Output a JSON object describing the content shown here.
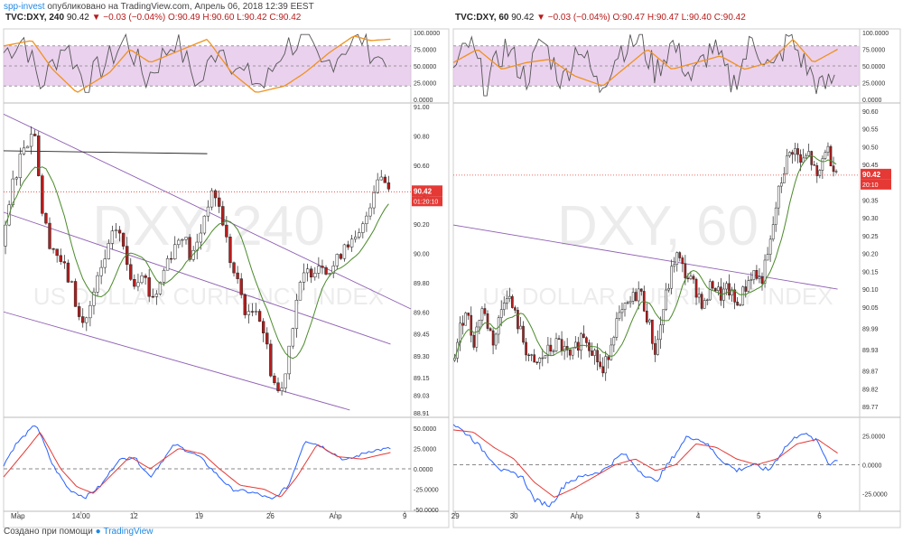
{
  "header": {
    "publisher": "spp-invest",
    "published_text": "опубликовано на TradingView.com, Апрель 06, 2018 12:39 EEST"
  },
  "footer": {
    "created_text": "Создано при помощи",
    "brand": "TradingView"
  },
  "colors": {
    "bull": "#ffffff",
    "bear": "#b71c1c",
    "wick": "#222222",
    "ma": "#4a8a2a",
    "stoch_k": "#555555",
    "stoch_d": "#f0921e",
    "rsi_band": "#e1bee7",
    "channel": "#8e5fb3",
    "macd": "#2962ff",
    "signal": "#e53935",
    "price_line": "#e53935"
  },
  "chart_data": [
    {
      "type": "candlestick",
      "symbol": "TVC:DXY",
      "interval": "240",
      "legend": {
        "prefix": "TVC:DXY, 240",
        "close": "90.42",
        "change": "▼ −0.03 (−0.04%)",
        "ohlc": "O:90.49 H:90.60 L:90.42 C:90.42"
      },
      "watermark_1": "DXY, 240",
      "watermark_2": "US DOLLAR CURRENCY INDEX",
      "price_ticks": [
        "91.00",
        "90.80",
        "90.60",
        "90.40",
        "90.20",
        "90.00",
        "89.80",
        "89.60",
        "89.45",
        "89.30",
        "89.15",
        "89.03",
        "88.91"
      ],
      "price_tick_values": [
        91.0,
        90.8,
        90.6,
        90.4,
        90.2,
        90.0,
        89.8,
        89.6,
        89.45,
        89.3,
        89.15,
        89.03,
        88.91
      ],
      "price_range": [
        88.88,
        91.02
      ],
      "last_price": "90.42",
      "last_value": 90.42,
      "countdown": "01:20:10",
      "x_ticks": [
        "Мар",
        "14:00",
        "12",
        "19",
        "26",
        "Апр",
        "9"
      ],
      "x_tick_pos": [
        0.035,
        0.19,
        0.32,
        0.48,
        0.655,
        0.815,
        0.985
      ],
      "ohlc_anchors": [
        [
          0.0,
          90.05
        ],
        [
          0.02,
          90.45
        ],
        [
          0.05,
          90.75
        ],
        [
          0.08,
          90.85
        ],
        [
          0.09,
          90.35
        ],
        [
          0.11,
          90.1
        ],
        [
          0.14,
          89.95
        ],
        [
          0.17,
          89.75
        ],
        [
          0.19,
          89.5
        ],
        [
          0.21,
          89.6
        ],
        [
          0.23,
          89.8
        ],
        [
          0.26,
          90.05
        ],
        [
          0.28,
          90.2
        ],
        [
          0.3,
          89.95
        ],
        [
          0.32,
          89.8
        ],
        [
          0.34,
          89.9
        ],
        [
          0.36,
          89.7
        ],
        [
          0.38,
          89.75
        ],
        [
          0.4,
          89.95
        ],
        [
          0.42,
          90.05
        ],
        [
          0.44,
          90.15
        ],
        [
          0.46,
          89.95
        ],
        [
          0.48,
          90.1
        ],
        [
          0.5,
          90.35
        ],
        [
          0.52,
          90.4
        ],
        [
          0.54,
          90.2
        ],
        [
          0.56,
          89.9
        ],
        [
          0.58,
          89.75
        ],
        [
          0.6,
          89.55
        ],
        [
          0.62,
          89.65
        ],
        [
          0.64,
          89.45
        ],
        [
          0.66,
          89.15
        ],
        [
          0.68,
          89.02
        ],
        [
          0.7,
          89.35
        ],
        [
          0.72,
          89.7
        ],
        [
          0.74,
          89.85
        ],
        [
          0.76,
          89.9
        ],
        [
          0.78,
          89.95
        ],
        [
          0.8,
          89.88
        ],
        [
          0.82,
          89.95
        ],
        [
          0.84,
          90.1
        ],
        [
          0.86,
          90.05
        ],
        [
          0.88,
          90.15
        ],
        [
          0.9,
          90.35
        ],
        [
          0.92,
          90.55
        ],
        [
          0.935,
          90.5
        ],
        [
          0.95,
          90.42
        ]
      ],
      "channel_lines": [
        [
          [
            0.0,
            90.95
          ],
          [
            1.0,
            89.62
          ]
        ],
        [
          [
            0.0,
            90.28
          ],
          [
            0.95,
            89.38
          ]
        ],
        [
          [
            0.0,
            89.6
          ],
          [
            0.85,
            88.93
          ]
        ],
        [
          [
            0.0,
            90.7
          ],
          [
            0.5,
            90.68
          ]
        ]
      ],
      "rsi": {
        "ticks": [
          "100.0000",
          "75.0000",
          "50.0000",
          "25.0000",
          "0.0000"
        ],
        "tick_values": [
          100,
          75,
          50,
          25,
          0
        ],
        "band": [
          20,
          80
        ],
        "k_anchors": [
          [
            0,
            70
          ],
          [
            0.05,
            92
          ],
          [
            0.09,
            20
          ],
          [
            0.15,
            85
          ],
          [
            0.2,
            25
          ],
          [
            0.26,
            60
          ],
          [
            0.3,
            90
          ],
          [
            0.35,
            30
          ],
          [
            0.42,
            90
          ],
          [
            0.48,
            20
          ],
          [
            0.53,
            85
          ],
          [
            0.58,
            40
          ],
          [
            0.64,
            20
          ],
          [
            0.69,
            80
          ],
          [
            0.74,
            88
          ],
          [
            0.78,
            45
          ],
          [
            0.84,
            80
          ],
          [
            0.88,
            92
          ],
          [
            0.92,
            60
          ],
          [
            0.95,
            70
          ]
        ],
        "d_anchors": [
          [
            0,
            80
          ],
          [
            0.07,
            88
          ],
          [
            0.12,
            45
          ],
          [
            0.18,
            10
          ],
          [
            0.26,
            40
          ],
          [
            0.31,
            75
          ],
          [
            0.36,
            55
          ],
          [
            0.42,
            70
          ],
          [
            0.5,
            90
          ],
          [
            0.56,
            40
          ],
          [
            0.62,
            10
          ],
          [
            0.69,
            20
          ],
          [
            0.74,
            40
          ],
          [
            0.8,
            70
          ],
          [
            0.86,
            95
          ],
          [
            0.9,
            88
          ],
          [
            0.95,
            90
          ]
        ]
      },
      "macd": {
        "ticks": [
          "50.0000",
          "25.0000",
          "0.0000",
          "-25.0000",
          "-50.0000"
        ],
        "tick_values": [
          50,
          25,
          0,
          -25,
          -50
        ],
        "range": [
          -52,
          62
        ],
        "line_anchors": [
          [
            0,
            5
          ],
          [
            0.03,
            30
          ],
          [
            0.08,
            55
          ],
          [
            0.12,
            5
          ],
          [
            0.16,
            -25
          ],
          [
            0.2,
            -35
          ],
          [
            0.24,
            -20
          ],
          [
            0.28,
            10
          ],
          [
            0.32,
            15
          ],
          [
            0.36,
            -10
          ],
          [
            0.42,
            30
          ],
          [
            0.48,
            15
          ],
          [
            0.52,
            -5
          ],
          [
            0.56,
            -25
          ],
          [
            0.62,
            -30
          ],
          [
            0.66,
            -38
          ],
          [
            0.7,
            -20
          ],
          [
            0.74,
            35
          ],
          [
            0.78,
            28
          ],
          [
            0.84,
            10
          ],
          [
            0.9,
            22
          ],
          [
            0.95,
            25
          ]
        ],
        "signal_anchors": [
          [
            0,
            -10
          ],
          [
            0.05,
            20
          ],
          [
            0.09,
            45
          ],
          [
            0.14,
            0
          ],
          [
            0.18,
            -22
          ],
          [
            0.22,
            -30
          ],
          [
            0.27,
            -5
          ],
          [
            0.31,
            15
          ],
          [
            0.36,
            0
          ],
          [
            0.43,
            25
          ],
          [
            0.49,
            18
          ],
          [
            0.53,
            0
          ],
          [
            0.58,
            -20
          ],
          [
            0.64,
            -25
          ],
          [
            0.68,
            -35
          ],
          [
            0.72,
            -10
          ],
          [
            0.77,
            30
          ],
          [
            0.82,
            15
          ],
          [
            0.88,
            12
          ],
          [
            0.95,
            20
          ]
        ]
      }
    },
    {
      "type": "candlestick",
      "symbol": "TVC:DXY",
      "interval": "60",
      "legend": {
        "prefix": "TVC:DXY, 60",
        "close": "90.42",
        "change": "▼ −0.03 (−0.04%)",
        "ohlc": "O:90.47 H:90.47 L:90.40 C:90.42"
      },
      "watermark_1": "DXY, 60",
      "watermark_2": "US DOLLAR CURRENCY INDEX",
      "price_ticks": [
        "90.60",
        "90.55",
        "90.50",
        "90.45",
        "90.40",
        "90.35",
        "90.30",
        "90.25",
        "90.20",
        "90.15",
        "90.10",
        "90.05",
        "89.99",
        "89.93",
        "89.87",
        "89.82",
        "89.77"
      ],
      "price_tick_values": [
        90.6,
        90.55,
        90.5,
        90.45,
        90.4,
        90.35,
        90.3,
        90.25,
        90.2,
        90.15,
        90.1,
        90.05,
        89.99,
        89.93,
        89.87,
        89.82,
        89.77
      ],
      "price_range": [
        89.74,
        90.62
      ],
      "last_price": "90.42",
      "last_value": 90.42,
      "countdown": "20:10",
      "x_ticks": [
        "29",
        "30",
        "Апр",
        "3",
        "4",
        "5",
        "6"
      ],
      "x_tick_pos": [
        0.005,
        0.15,
        0.305,
        0.455,
        0.605,
        0.755,
        0.905
      ],
      "ohlc_anchors": [
        [
          0.0,
          89.9
        ],
        [
          0.03,
          90.05
        ],
        [
          0.05,
          89.95
        ],
        [
          0.07,
          90.05
        ],
        [
          0.1,
          89.95
        ],
        [
          0.13,
          90.1
        ],
        [
          0.16,
          90.0
        ],
        [
          0.18,
          89.93
        ],
        [
          0.2,
          89.88
        ],
        [
          0.23,
          89.92
        ],
        [
          0.26,
          89.95
        ],
        [
          0.29,
          89.9
        ],
        [
          0.32,
          89.98
        ],
        [
          0.35,
          89.92
        ],
        [
          0.37,
          89.86
        ],
        [
          0.4,
          90.0
        ],
        [
          0.43,
          90.05
        ],
        [
          0.46,
          90.1
        ],
        [
          0.48,
          90.02
        ],
        [
          0.5,
          89.92
        ],
        [
          0.52,
          90.05
        ],
        [
          0.55,
          90.2
        ],
        [
          0.57,
          90.15
        ],
        [
          0.6,
          90.1
        ],
        [
          0.62,
          90.05
        ],
        [
          0.64,
          90.12
        ],
        [
          0.66,
          90.08
        ],
        [
          0.68,
          90.1
        ],
        [
          0.7,
          90.05
        ],
        [
          0.72,
          90.1
        ],
        [
          0.74,
          90.15
        ],
        [
          0.76,
          90.12
        ],
        [
          0.78,
          90.2
        ],
        [
          0.8,
          90.35
        ],
        [
          0.82,
          90.45
        ],
        [
          0.84,
          90.5
        ],
        [
          0.86,
          90.45
        ],
        [
          0.88,
          90.48
        ],
        [
          0.9,
          90.4
        ],
        [
          0.92,
          90.5
        ],
        [
          0.94,
          90.45
        ],
        [
          0.955,
          90.42
        ]
      ],
      "channel_lines": [
        [
          [
            0.0,
            90.28
          ],
          [
            0.95,
            90.1
          ]
        ]
      ],
      "rsi": {
        "ticks": [
          "100.0000",
          "75.0000",
          "50.0000",
          "25.0000",
          "0.0000"
        ],
        "tick_values": [
          100,
          75,
          50,
          25,
          0
        ],
        "band": [
          20,
          80
        ],
        "k_anchors": [
          [
            0,
            40
          ],
          [
            0.04,
            85
          ],
          [
            0.08,
            20
          ],
          [
            0.13,
            80
          ],
          [
            0.18,
            30
          ],
          [
            0.22,
            90
          ],
          [
            0.27,
            25
          ],
          [
            0.31,
            85
          ],
          [
            0.36,
            15
          ],
          [
            0.41,
            75
          ],
          [
            0.46,
            90
          ],
          [
            0.5,
            40
          ],
          [
            0.54,
            85
          ],
          [
            0.59,
            30
          ],
          [
            0.64,
            80
          ],
          [
            0.69,
            20
          ],
          [
            0.74,
            90
          ],
          [
            0.79,
            40
          ],
          [
            0.83,
            95
          ],
          [
            0.87,
            50
          ],
          [
            0.91,
            15
          ],
          [
            0.95,
            35
          ]
        ],
        "d_anchors": [
          [
            0,
            55
          ],
          [
            0.06,
            75
          ],
          [
            0.12,
            45
          ],
          [
            0.18,
            55
          ],
          [
            0.24,
            60
          ],
          [
            0.3,
            35
          ],
          [
            0.37,
            20
          ],
          [
            0.43,
            50
          ],
          [
            0.48,
            75
          ],
          [
            0.54,
            45
          ],
          [
            0.6,
            55
          ],
          [
            0.66,
            65
          ],
          [
            0.72,
            45
          ],
          [
            0.78,
            55
          ],
          [
            0.84,
            90
          ],
          [
            0.89,
            55
          ],
          [
            0.95,
            75
          ]
        ]
      },
      "macd": {
        "ticks": [
          "25.0000",
          "0.0000",
          "-25.0000"
        ],
        "tick_values": [
          25,
          0,
          -25
        ],
        "range": [
          -40,
          40
        ],
        "line_anchors": [
          [
            0,
            35
          ],
          [
            0.04,
            25
          ],
          [
            0.08,
            10
          ],
          [
            0.12,
            -5
          ],
          [
            0.17,
            -10
          ],
          [
            0.2,
            -30
          ],
          [
            0.24,
            -35
          ],
          [
            0.28,
            -15
          ],
          [
            0.32,
            -10
          ],
          [
            0.37,
            -5
          ],
          [
            0.42,
            10
          ],
          [
            0.46,
            -5
          ],
          [
            0.5,
            -15
          ],
          [
            0.54,
            5
          ],
          [
            0.58,
            25
          ],
          [
            0.62,
            20
          ],
          [
            0.66,
            5
          ],
          [
            0.7,
            -5
          ],
          [
            0.74,
            0
          ],
          [
            0.78,
            -5
          ],
          [
            0.82,
            15
          ],
          [
            0.86,
            28
          ],
          [
            0.9,
            20
          ],
          [
            0.93,
            0
          ],
          [
            0.95,
            5
          ]
        ],
        "signal_anchors": [
          [
            0,
            30
          ],
          [
            0.05,
            28
          ],
          [
            0.1,
            15
          ],
          [
            0.15,
            5
          ],
          [
            0.2,
            -15
          ],
          [
            0.25,
            -28
          ],
          [
            0.3,
            -20
          ],
          [
            0.35,
            -10
          ],
          [
            0.4,
            0
          ],
          [
            0.45,
            5
          ],
          [
            0.5,
            -5
          ],
          [
            0.55,
            0
          ],
          [
            0.6,
            18
          ],
          [
            0.65,
            15
          ],
          [
            0.7,
            5
          ],
          [
            0.75,
            0
          ],
          [
            0.8,
            5
          ],
          [
            0.85,
            18
          ],
          [
            0.9,
            22
          ],
          [
            0.95,
            10
          ]
        ]
      }
    }
  ]
}
